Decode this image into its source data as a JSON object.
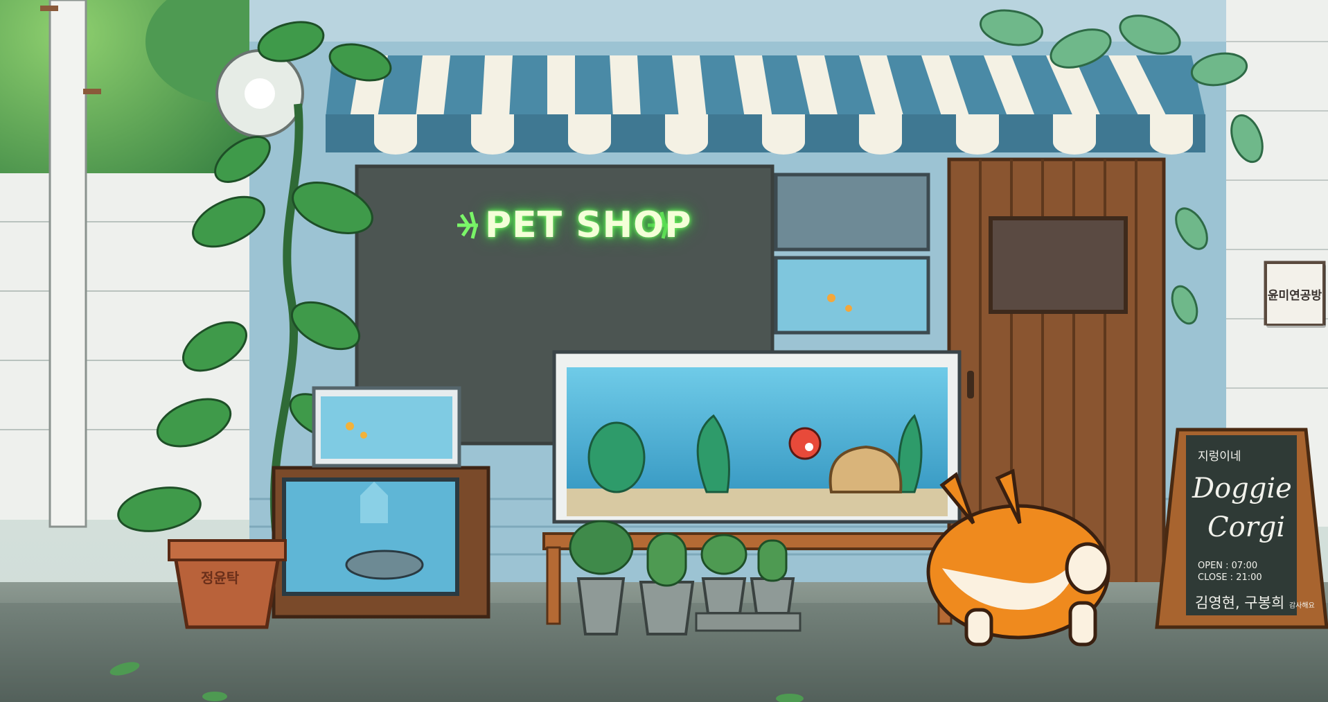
{
  "scene": {
    "neon_sign": "PET SHOP",
    "wall_plaque": "윤미연공방",
    "pot_label": "정윤탁",
    "chalkboard": {
      "line1": "지렁이네",
      "line2": "Doggie",
      "line3": "Corgi",
      "open": "OPEN : 07:00",
      "close": "CLOSE : 21:00",
      "names": "김영현, 구봉희",
      "names_suffix": "감사해요"
    }
  },
  "colors": {
    "awning_blue": "#4a8aa6",
    "awning_white": "#f4f1e4",
    "neon_green": "#7dff6a",
    "door_brown": "#8a5530",
    "aquarium_water": "#4fb3d6",
    "corgi_orange": "#ef8a1e",
    "wall_white": "#e9ece8",
    "shop_wall_blue": "#9cc3d3"
  }
}
